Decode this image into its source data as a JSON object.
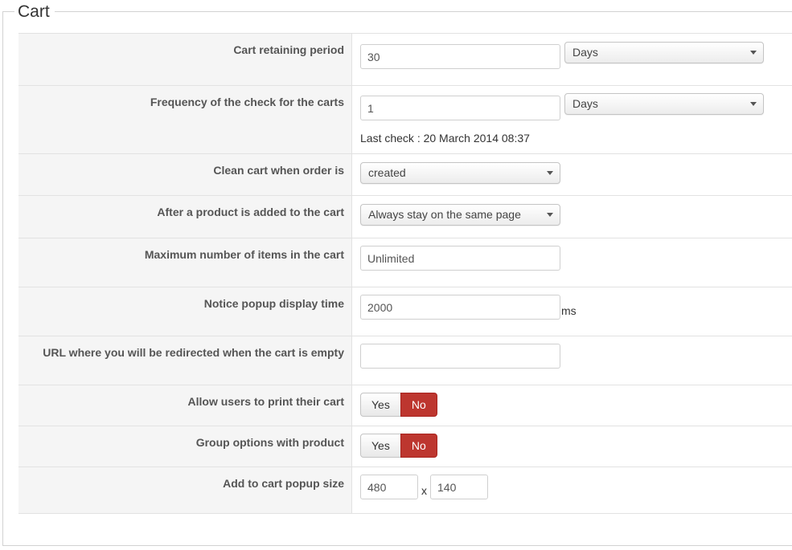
{
  "legend": "Cart",
  "rows": {
    "retaining": {
      "label": "Cart retaining period",
      "value": "30",
      "unit": "Days"
    },
    "frequency": {
      "label": "Frequency of the check for the carts",
      "value": "1",
      "unit": "Days",
      "last_check": "Last check : 20 March 2014 08:37"
    },
    "clean": {
      "label": "Clean cart when order is",
      "selected": "created"
    },
    "after_add": {
      "label": "After a product is added to the cart",
      "selected": "Always stay on the same page"
    },
    "max_items": {
      "label": "Maximum number of items in the cart",
      "value": "Unlimited"
    },
    "notice": {
      "label": "Notice popup display time",
      "value": "2000",
      "suffix": "ms"
    },
    "empty_url": {
      "label": "URL where you will be redirected when the cart is empty",
      "value": ""
    },
    "print": {
      "label": "Allow users to print their cart",
      "yes": "Yes",
      "no": "No",
      "selected": "No"
    },
    "group": {
      "label": "Group options with product",
      "yes": "Yes",
      "no": "No",
      "selected": "No"
    },
    "popup_size": {
      "label": "Add to cart popup size",
      "width": "480",
      "separator": "x",
      "height": "140"
    }
  },
  "colors": {
    "active_no": "#bd362f",
    "label_bg": "#f5f5f5"
  }
}
